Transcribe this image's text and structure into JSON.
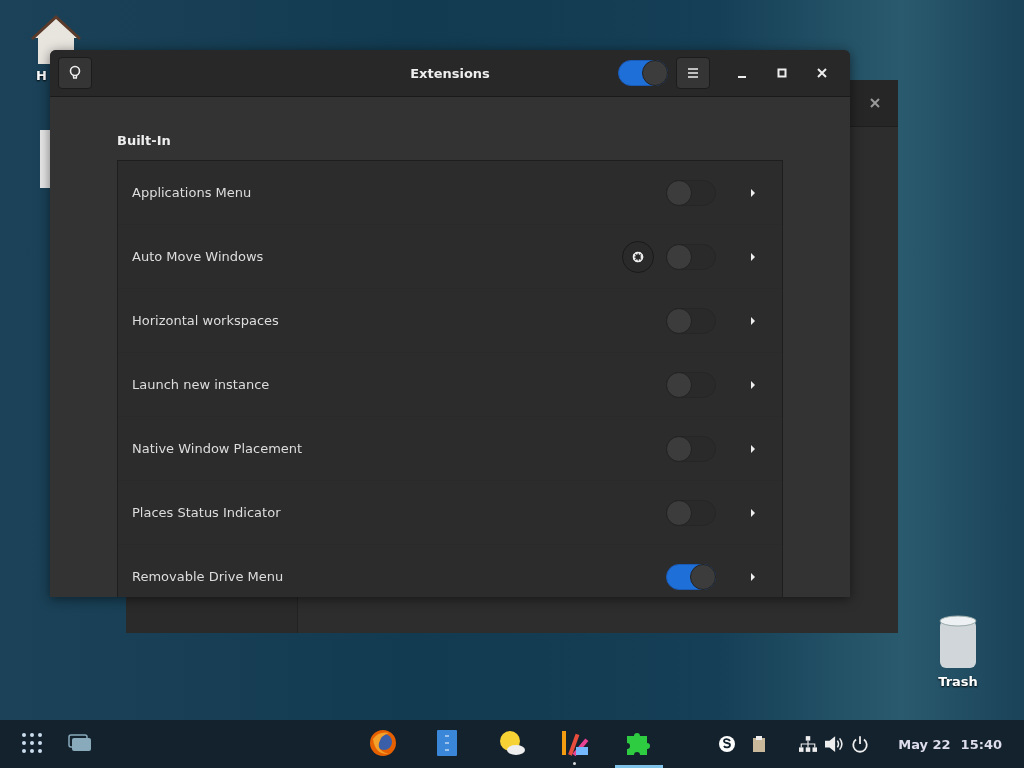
{
  "desktop_icons": [
    {
      "kind": "home",
      "label": "H"
    },
    {
      "kind": "trash",
      "label": "Trash"
    }
  ],
  "window": {
    "title": "Extensions",
    "master_switch": {
      "on": true
    }
  },
  "section": {
    "title": "Built-In"
  },
  "extensions": [
    {
      "name": "Applications Menu",
      "on": false,
      "has_settings": false
    },
    {
      "name": "Auto Move Windows",
      "on": false,
      "has_settings": true
    },
    {
      "name": "Horizontal workspaces",
      "on": false,
      "has_settings": false
    },
    {
      "name": "Launch new instance",
      "on": false,
      "has_settings": false
    },
    {
      "name": "Native Window Placement",
      "on": false,
      "has_settings": false
    },
    {
      "name": "Places Status Indicator",
      "on": false,
      "has_settings": false
    },
    {
      "name": "Removable Drive Menu",
      "on": true,
      "has_settings": false
    }
  ],
  "taskbar": {
    "apps": [
      {
        "kind": "browser",
        "active": false,
        "running": false
      },
      {
        "kind": "files",
        "active": false,
        "running": false
      },
      {
        "kind": "weather",
        "active": false,
        "running": false
      },
      {
        "kind": "palette",
        "active": false,
        "running": true
      },
      {
        "kind": "puzzle",
        "active": true,
        "running": true
      }
    ],
    "date": "May 22",
    "time": "15:40"
  }
}
